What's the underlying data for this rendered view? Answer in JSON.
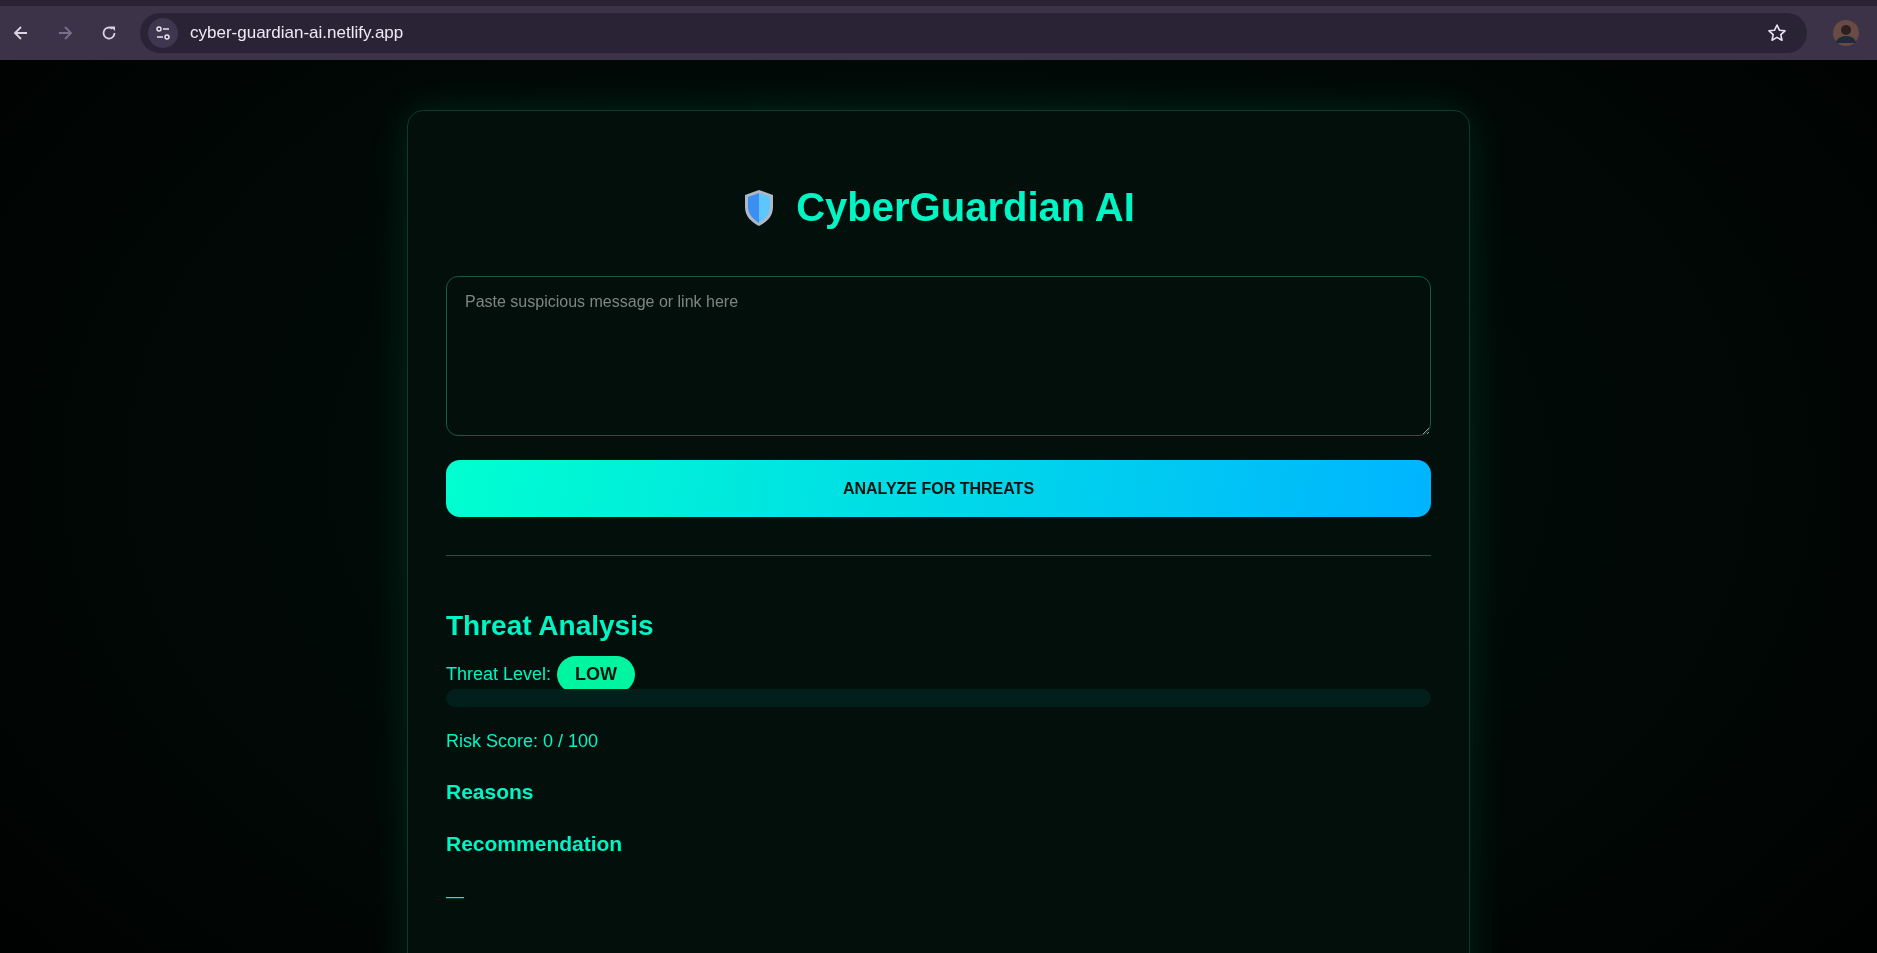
{
  "browser": {
    "url": "cyber-guardian-ai.netlify.app",
    "forward_disabled": true
  },
  "app": {
    "title": "CyberGuardian AI",
    "input": {
      "placeholder": "Paste suspicious message or link here"
    },
    "analyze_button": "ANALYZE FOR THREATS",
    "analysis": {
      "heading": "Threat Analysis",
      "threat_level_label": "Threat Level:",
      "threat_level": "LOW",
      "risk_bar": {
        "level": 0
      },
      "risk_score": "Risk Score: 0 / 100",
      "reasons_heading": "Reasons",
      "recommendation_heading": "Recommendation",
      "recommendation": "—"
    }
  }
}
